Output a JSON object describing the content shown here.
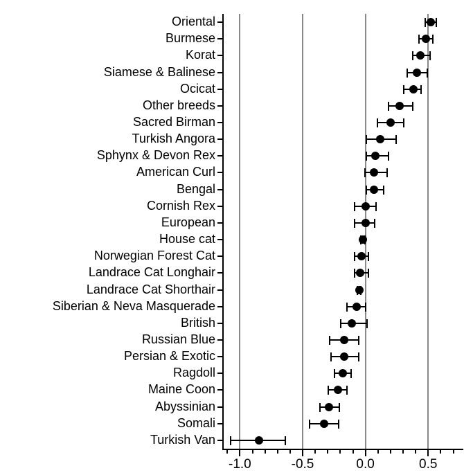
{
  "chart_data": {
    "type": "scatter",
    "subtype": "forest-plot-dot-with-error-bars",
    "title": "",
    "subtitle": "",
    "xlabel": "",
    "ylabel": "",
    "orientation": "horizontal",
    "grid": {
      "vertical": true,
      "horizontal": false,
      "gridline_color": "#888888"
    },
    "legend": {
      "present": false,
      "position": "none"
    },
    "marker_color": "#000000",
    "xlim": [
      -1.14,
      0.78
    ],
    "xticks": [
      -1.0,
      -0.5,
      0.0,
      0.5
    ],
    "xticklabels": [
      "-1.0",
      "-0.5",
      "0.0",
      "0.5"
    ],
    "xtick_minor_step": 0.1,
    "gridlines_at": [
      -1.0,
      -0.5,
      0.0,
      0.5
    ],
    "categories": [
      "Oriental",
      "Burmese",
      "Korat",
      "Siamese & Balinese",
      "Ocicat",
      "Other breeds",
      "Sacred Birman",
      "Turkish Angora",
      "Sphynx & Devon Rex",
      "American Curl",
      "Bengal",
      "Cornish Rex",
      "European",
      "House cat",
      "Norwegian Forest Cat",
      "Landrace Cat Longhair",
      "Landrace Cat Shorthair",
      "Siberian & Neva Masquerade",
      "British",
      "Russian Blue",
      "Persian & Exotic",
      "Ragdoll",
      "Maine Coon",
      "Abyssinian",
      "Somali",
      "Turkish Van"
    ],
    "values": [
      0.52,
      0.48,
      0.44,
      0.41,
      0.38,
      0.27,
      0.2,
      0.12,
      0.08,
      0.07,
      0.07,
      0.0,
      0.0,
      -0.02,
      -0.03,
      -0.04,
      -0.05,
      -0.07,
      -0.11,
      -0.17,
      -0.17,
      -0.18,
      -0.22,
      -0.29,
      -0.33,
      -0.85
    ],
    "ci_low": [
      0.47,
      0.42,
      0.37,
      0.33,
      0.3,
      0.18,
      0.09,
      0.0,
      0.0,
      -0.01,
      0.0,
      -0.09,
      -0.09,
      -0.04,
      -0.09,
      -0.09,
      -0.07,
      -0.15,
      -0.2,
      -0.29,
      -0.28,
      -0.25,
      -0.3,
      -0.37,
      -0.45,
      -1.08
    ],
    "ci_high": [
      0.57,
      0.54,
      0.52,
      0.5,
      0.45,
      0.38,
      0.31,
      0.25,
      0.19,
      0.18,
      0.15,
      0.09,
      0.08,
      0.0,
      0.03,
      0.03,
      -0.03,
      0.01,
      0.02,
      -0.05,
      -0.05,
      -0.11,
      -0.14,
      -0.2,
      -0.21,
      -0.63
    ]
  }
}
